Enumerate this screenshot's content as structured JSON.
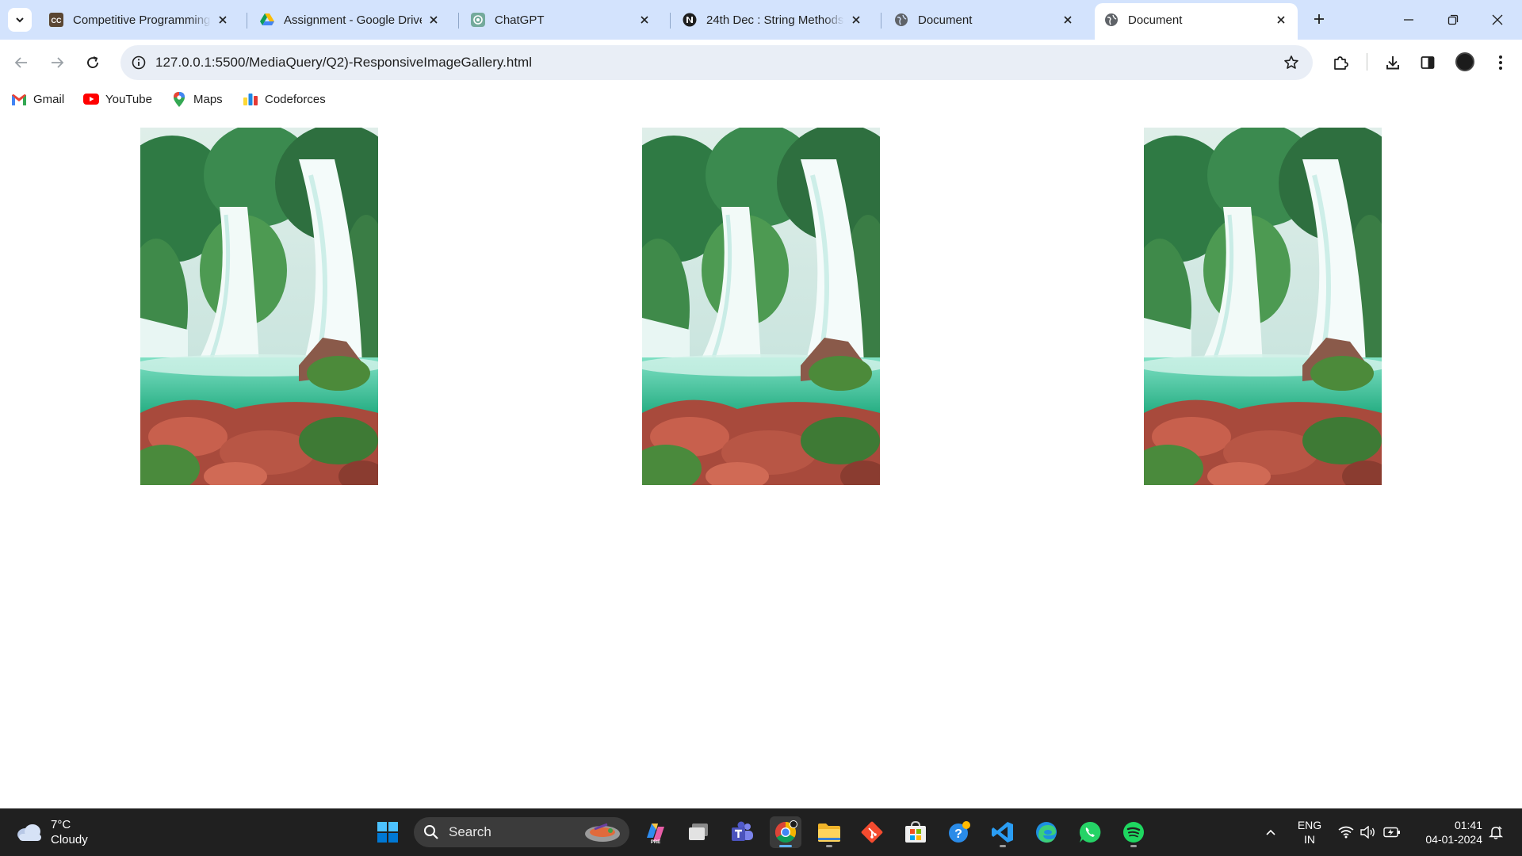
{
  "browser": {
    "tabs": [
      {
        "title": "Competitive Programming",
        "icon": "cc-icon",
        "active": false
      },
      {
        "title": "Assignment - Google Drive",
        "icon": "google-drive-icon",
        "active": false
      },
      {
        "title": "ChatGPT",
        "icon": "chatgpt-icon",
        "active": false
      },
      {
        "title": "24th Dec : String Methods",
        "icon": "notion-icon",
        "active": false
      },
      {
        "title": "Document",
        "icon": "globe-icon",
        "active": false
      },
      {
        "title": "Document",
        "icon": "globe-icon",
        "active": true
      }
    ],
    "address_bar": {
      "url": "127.0.0.1:5500/MediaQuery/Q2)-ResponsiveImageGallery.html"
    },
    "bookmarks": [
      {
        "label": "Gmail",
        "icon": "gmail-icon"
      },
      {
        "label": "YouTube",
        "icon": "youtube-icon"
      },
      {
        "label": "Maps",
        "icon": "maps-icon"
      },
      {
        "label": "Codeforces",
        "icon": "codeforces-icon"
      }
    ],
    "accent_color": "#d3e3fd"
  },
  "page": {
    "gallery": {
      "images": [
        {
          "subject": "waterfall"
        },
        {
          "subject": "waterfall"
        },
        {
          "subject": "waterfall"
        }
      ]
    }
  },
  "taskbar": {
    "weather": {
      "temperature": "7°C",
      "condition": "Cloudy"
    },
    "search_placeholder": "Search",
    "pinned_apps": [
      "windows-start-icon",
      "copilot-icon",
      "task-view-icon",
      "teams-icon",
      "chrome-icon",
      "file-explorer-icon",
      "git-icon",
      "microsoft-store-icon",
      "help-icon",
      "vscode-icon",
      "edge-icon",
      "whatsapp-icon",
      "spotify-icon"
    ],
    "language": {
      "line1": "ENG",
      "line2": "IN"
    },
    "clock": {
      "time": "01:41",
      "date": "04-01-2024"
    },
    "color": "#202020"
  }
}
